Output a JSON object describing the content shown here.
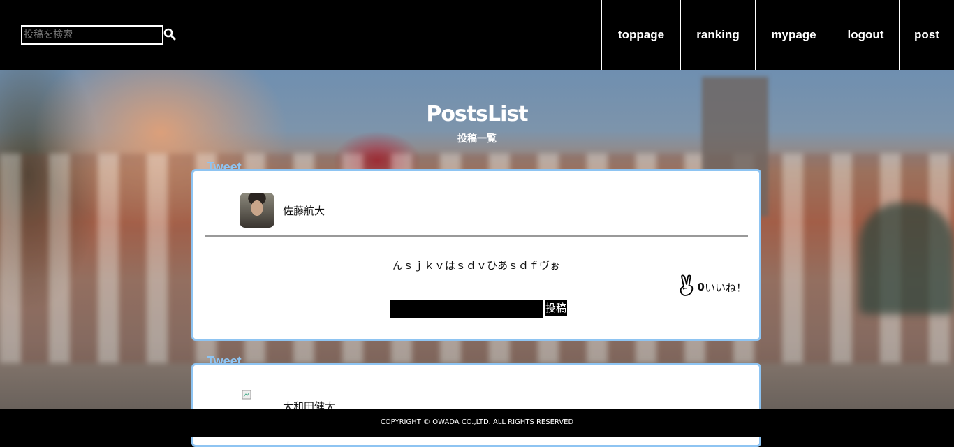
{
  "header": {
    "search_placeholder": "投稿を検索",
    "nav": [
      "toppage",
      "ranking",
      "mypage",
      "logout",
      "post"
    ]
  },
  "hero": {
    "title": "PostsList",
    "subtitle": "投稿一覧"
  },
  "posts": [
    {
      "tweet_label": "Tweet",
      "username": "佐藤航大",
      "body": "んｓｊｋｖはｓｄｖひあｓｄｆヴぉ",
      "like_count": "0",
      "like_label": "いいね！",
      "comment_button": "投稿"
    },
    {
      "tweet_label": "Tweet",
      "username": "大和田健太"
    }
  ],
  "footer": {
    "copyright": "COPYRIGHT © OWADA CO.,LTD. ALL RIGHTS RESERVED"
  }
}
